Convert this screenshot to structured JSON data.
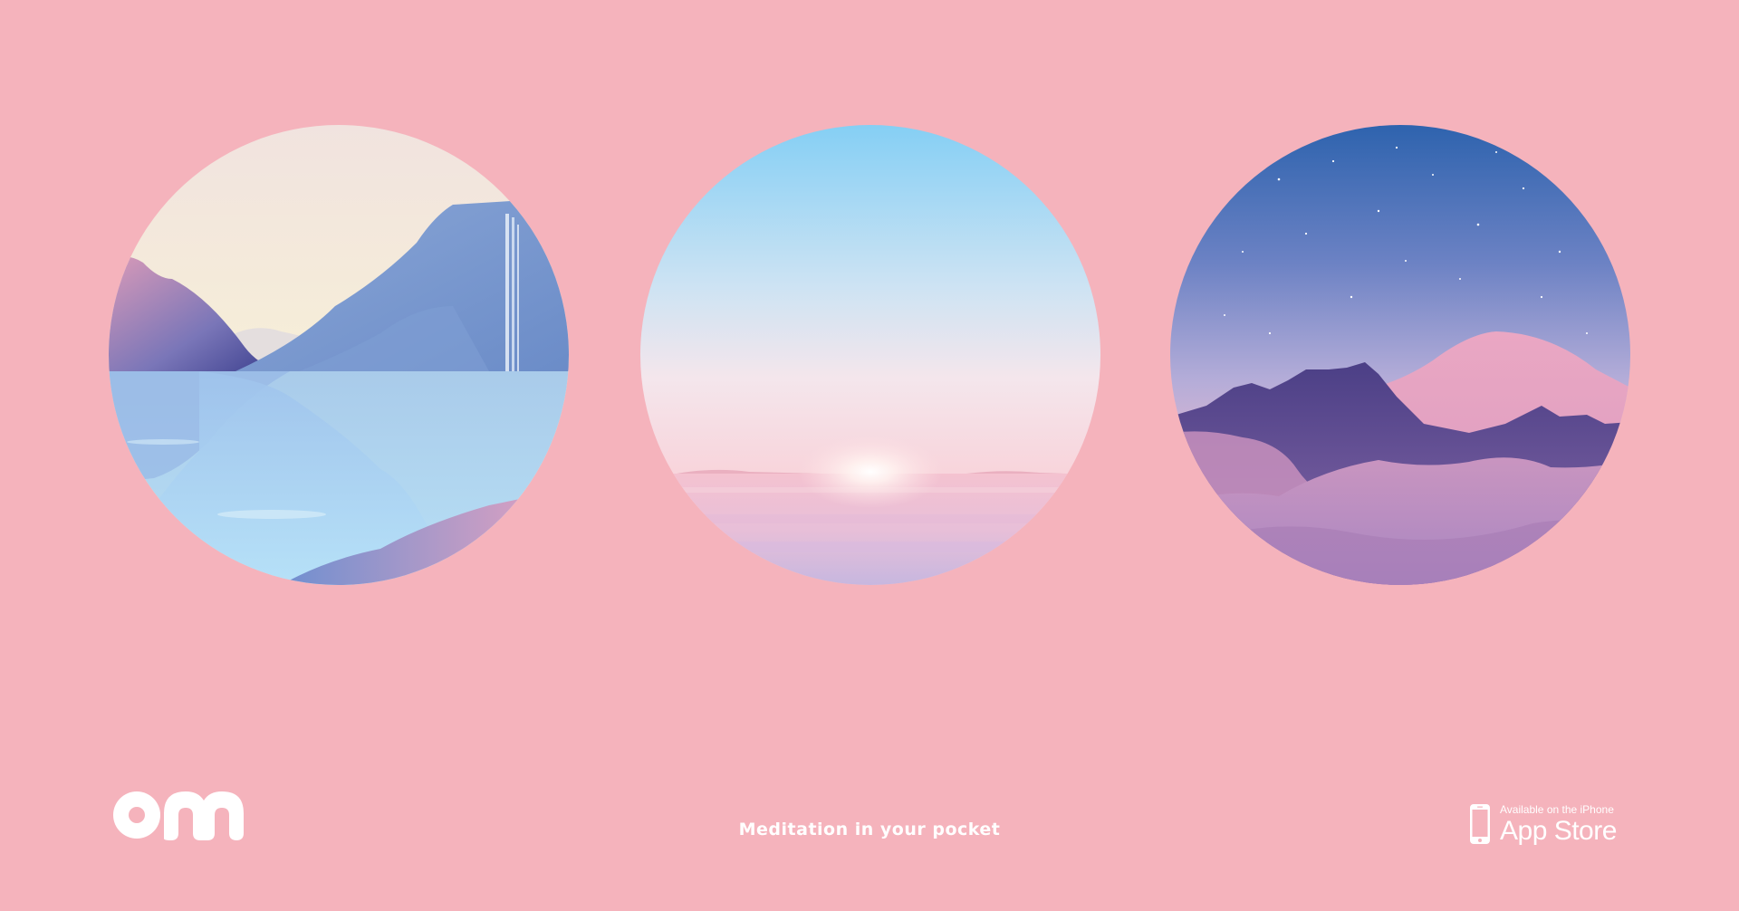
{
  "brand": {
    "logo_text": "om",
    "background_color": "#f5b3bc",
    "text_color": "#ffffff"
  },
  "tagline": "Meditation in your pocket",
  "app_store_badge": {
    "small_text": "Available on the iPhone",
    "large_text": "App Store",
    "icon": "iphone-icon"
  },
  "scenes": [
    {
      "name": "lake-waterfall-scene"
    },
    {
      "name": "sunrise-sea-scene"
    },
    {
      "name": "night-mountains-scene"
    }
  ]
}
